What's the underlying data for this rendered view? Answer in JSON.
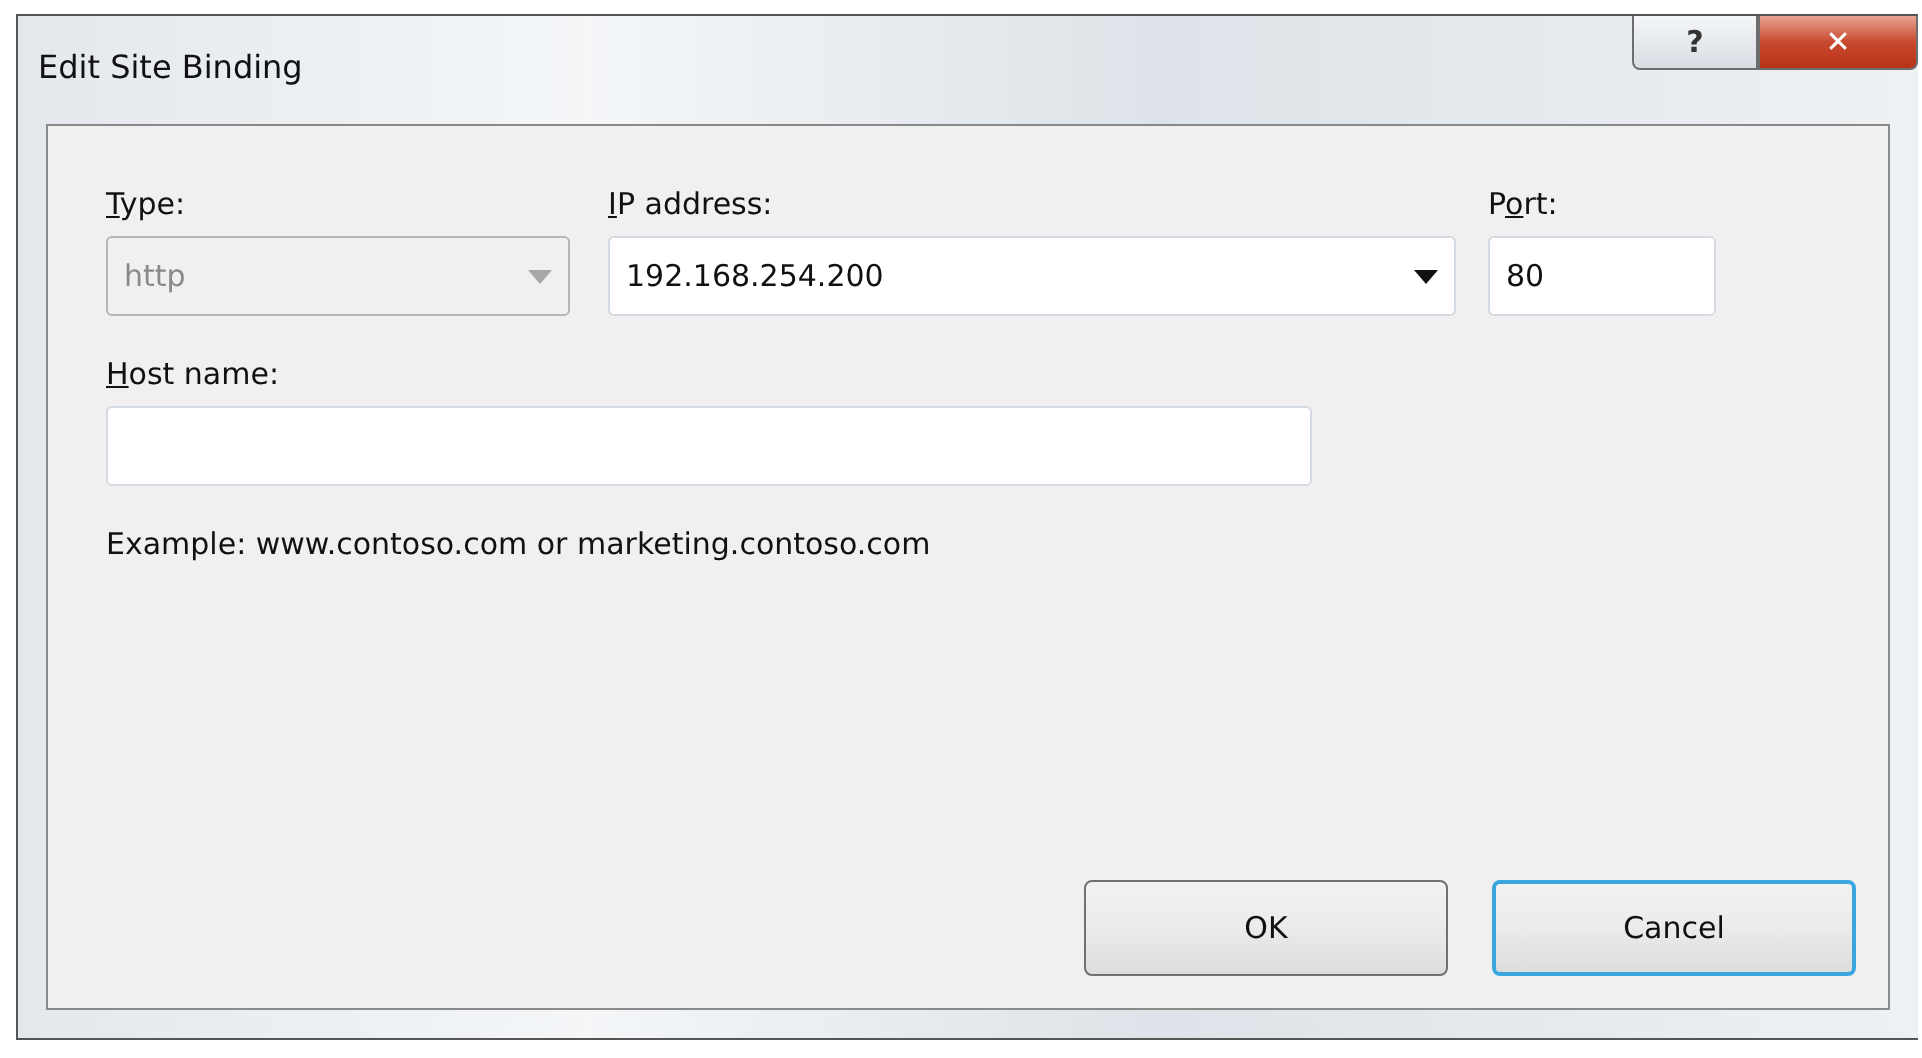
{
  "window": {
    "title": "Edit Site Binding",
    "help_button": "?",
    "close_button": "✕"
  },
  "fields": [
    {
      "kind": "combo",
      "label": {
        "key": "T",
        "after": "ype:"
      },
      "value": "http",
      "disabled": true
    },
    {
      "kind": "combo",
      "label": {
        "key": "I",
        "after": "P address:"
      },
      "value": "192.168.254.200",
      "disabled": false
    },
    {
      "kind": "text",
      "label": {
        "before": "P",
        "key": "o",
        "after": "rt:"
      },
      "value": "80",
      "disabled": false
    }
  ],
  "host_name": {
    "label": {
      "key": "H",
      "after": "ost name:"
    }
  },
  "example": "Example: www.contoso.com or marketing.contoso.com",
  "buttons": [
    {
      "label": "OK",
      "focused": false
    },
    {
      "label": "Cancel",
      "focused": true
    }
  ]
}
